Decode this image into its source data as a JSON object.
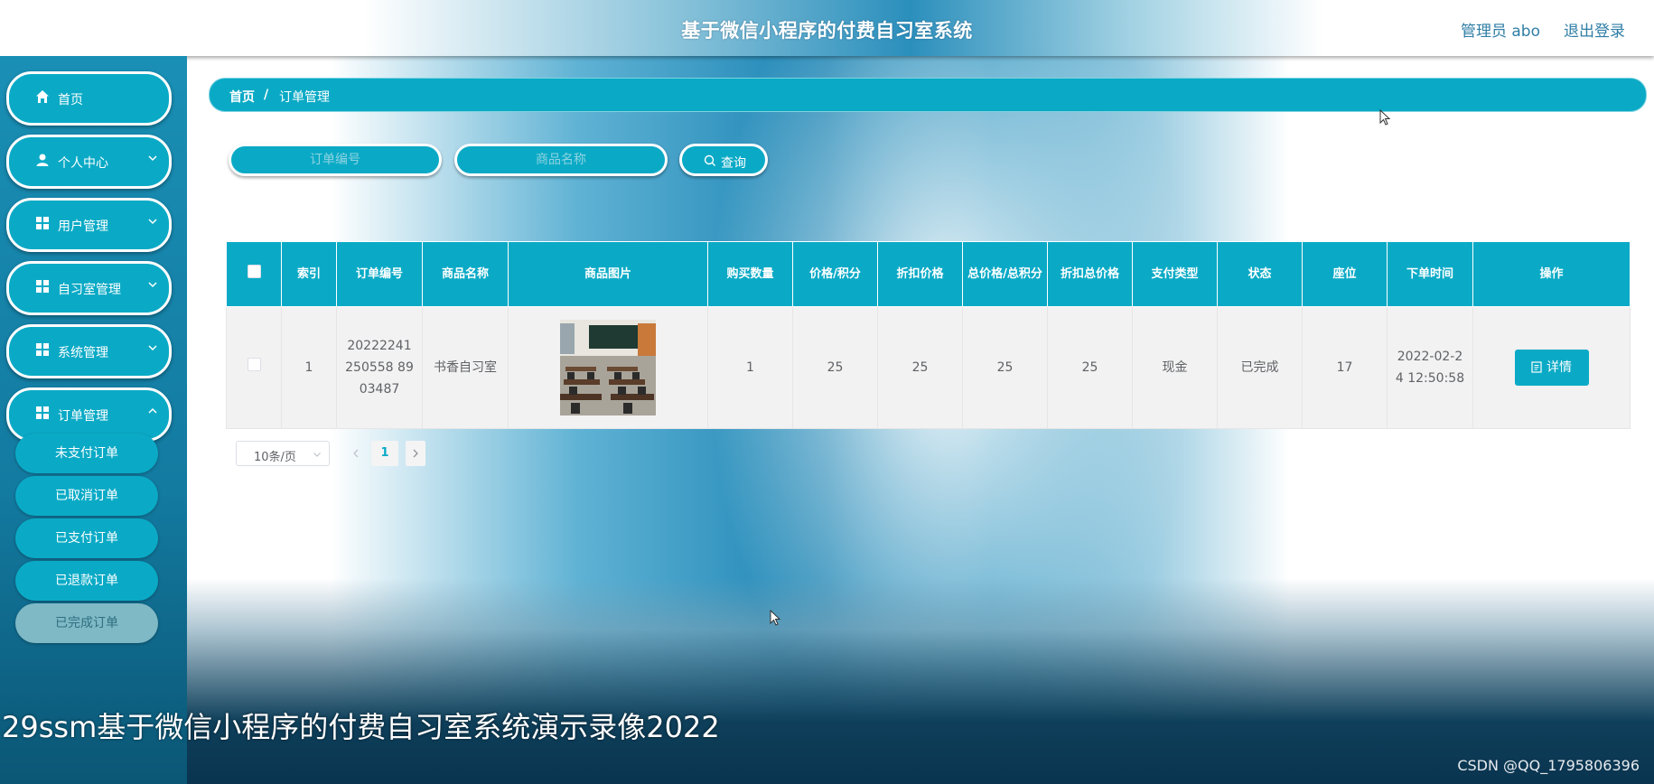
{
  "header": {
    "title": "基于微信小程序的付费自习室系统",
    "admin": "管理员 abo",
    "logout": "退出登录"
  },
  "sidebar": {
    "items": [
      {
        "label": "首页",
        "icon": "home-icon"
      },
      {
        "label": "个人中心",
        "icon": "user-icon"
      },
      {
        "label": "用户管理",
        "icon": "grid-icon"
      },
      {
        "label": "自习室管理",
        "icon": "grid-icon"
      },
      {
        "label": "系统管理",
        "icon": "grid-icon"
      },
      {
        "label": "订单管理",
        "icon": "grid-icon"
      }
    ],
    "submenu": [
      {
        "label": "未支付订单"
      },
      {
        "label": "已取消订单"
      },
      {
        "label": "已支付订单"
      },
      {
        "label": "已退款订单"
      },
      {
        "label": "已完成订单",
        "active": true
      }
    ]
  },
  "breadcrumb": {
    "home": "首页",
    "separator": "/",
    "current": "订单管理"
  },
  "search": {
    "order_no_placeholder": "订单编号",
    "product_placeholder": "商品名称",
    "button": "查询"
  },
  "table": {
    "headers": [
      "索引",
      "订单编号",
      "商品名称",
      "商品图片",
      "购买数量",
      "价格/积分",
      "折扣价格",
      "总价格/总积分",
      "折扣总价格",
      "支付类型",
      "状态",
      "座位",
      "下单时间",
      "操作"
    ],
    "rows": [
      {
        "index": "1",
        "order_no": "20222241250558 8903487",
        "product": "书香自习室",
        "quantity": "1",
        "price": "25",
        "discount_price": "25",
        "total_price": "25",
        "discount_total": "25",
        "pay_type": "现金",
        "status": "已完成",
        "seat": "17",
        "time": "2022-02-24 12:50:58",
        "action": "详情"
      }
    ]
  },
  "pagination": {
    "page_size": "10条/页",
    "current_page": "1"
  },
  "caption": "29ssm基于微信小程序的付费自习室系统演示录像2022",
  "watermark": "CSDN @QQ_1795806396",
  "colors": {
    "accent": "#0aaac6",
    "sidebar": "#137aa0",
    "active_sub": "#7fb9c6"
  }
}
